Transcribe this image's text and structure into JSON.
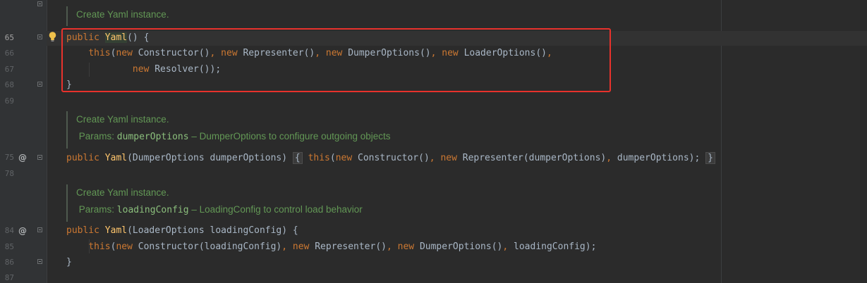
{
  "editor": {
    "line_numbers": [
      "65",
      "66",
      "67",
      "68",
      "69",
      "75",
      "78",
      "84",
      "85",
      "86",
      "87"
    ],
    "doc1": {
      "text": "Create Yaml instance."
    },
    "doc2": {
      "text": "Create Yaml instance.",
      "params_label": "Params:",
      "param_name": "dumperOptions",
      "param_desc": "– DumperOptions to configure outgoing objects"
    },
    "doc3": {
      "text": "Create Yaml instance.",
      "params_label": "Params:",
      "param_name": "loadingConfig",
      "param_desc": "– LoadingConfig to control load behavior"
    },
    "lines": {
      "l65": {
        "kw": "public",
        "name": "Yaml",
        "rest": "() {"
      },
      "l66": {
        "indent": "    ",
        "this": "this",
        "p1": "(",
        "new1": "new",
        "t1": " Constructor()",
        "sep1": ", ",
        "new2": "new",
        "t2": " Representer()",
        "sep2": ", ",
        "new3": "new",
        "t3": " DumperOptions()",
        "sep3": ", ",
        "new4": "new",
        "t4": " LoaderOptions()",
        "sep4": ","
      },
      "l67": {
        "indent": "            ",
        "new": "new",
        "rest": " Resolver());"
      },
      "l68": {
        "text": "}"
      },
      "l75": {
        "kw": "public",
        "name": "Yaml",
        "params": "(DumperOptions dumperOptions) ",
        "fold_open": "{",
        "this": "this",
        "p1": "(",
        "new1": "new",
        "t1": " Constructor()",
        "sep1": ", ",
        "new2": "new",
        "t2": " Representer(dumperOptions)",
        "sep2": ", ",
        "t3": "dumperOptions);",
        "fold_close": "}"
      },
      "l84": {
        "kw": "public",
        "name": "Yaml",
        "rest": "(LoaderOptions loadingConfig) {"
      },
      "l85": {
        "indent": "    ",
        "this": "this",
        "p1": "(",
        "new1": "new",
        "t1": " Constructor(loadingConfig)",
        "sep1": ", ",
        "new2": "new",
        "t2": " Representer()",
        "sep2": ", ",
        "new3": "new",
        "t3": " DumperOptions()",
        "sep3": ", ",
        "t4": "loadingConfig);"
      },
      "l86": {
        "text": "}"
      }
    },
    "gutter_icons": {
      "bulb": "lightbulb-icon",
      "at1": "@",
      "at2": "@"
    },
    "colors": {
      "background": "#2b2b2b",
      "keyword": "#cc7832",
      "method": "#ffc66d",
      "doc_comment": "#629755",
      "highlight_box": "#e8322c"
    }
  }
}
